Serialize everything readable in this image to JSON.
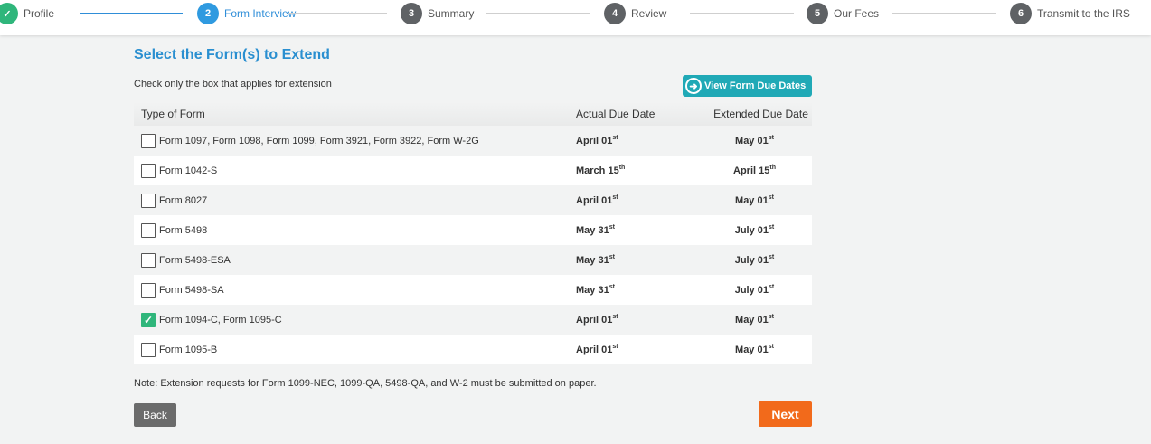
{
  "stepper": {
    "steps": [
      {
        "number": "✓",
        "label": "Profile",
        "state": "done"
      },
      {
        "number": "2",
        "label": "Form Interview",
        "state": "active"
      },
      {
        "number": "3",
        "label": "Summary",
        "state": "pending"
      },
      {
        "number": "4",
        "label": "Review",
        "state": "pending"
      },
      {
        "number": "5",
        "label": "Our Fees",
        "state": "pending"
      },
      {
        "number": "6",
        "label": "Transmit to the IRS",
        "state": "pending"
      }
    ]
  },
  "main": {
    "title": "Select the Form(s) to Extend",
    "instruction": "Check only the box that applies for extension",
    "due_dates_button": "View Form Due Dates",
    "table": {
      "headers": [
        "Type of Form",
        "Actual Due Date",
        "Extended Due Date"
      ],
      "rows": [
        {
          "form": "Form 1097, Form 1098, Form 1099, Form 3921, Form 3922, Form W-2G",
          "actual": "April 01",
          "actual_sup": "st",
          "extended": "May 01",
          "extended_sup": "st",
          "checked": false
        },
        {
          "form": "Form 1042-S",
          "actual": "March 15",
          "actual_sup": "th",
          "extended": "April 15",
          "extended_sup": "th",
          "checked": false
        },
        {
          "form": "Form 8027",
          "actual": "April 01",
          "actual_sup": "st",
          "extended": "May 01",
          "extended_sup": "st",
          "checked": false
        },
        {
          "form": "Form 5498",
          "actual": "May 31",
          "actual_sup": "st",
          "extended": "July 01",
          "extended_sup": "st",
          "checked": false
        },
        {
          "form": "Form 5498-ESA",
          "actual": "May 31",
          "actual_sup": "st",
          "extended": "July 01",
          "extended_sup": "st",
          "checked": false
        },
        {
          "form": "Form 5498-SA",
          "actual": "May 31",
          "actual_sup": "st",
          "extended": "July 01",
          "extended_sup": "st",
          "checked": false
        },
        {
          "form": "Form 1094-C, Form 1095-C",
          "actual": "April 01",
          "actual_sup": "st",
          "extended": "May 01",
          "extended_sup": "st",
          "checked": true
        },
        {
          "form": "Form 1095-B",
          "actual": "April 01",
          "actual_sup": "st",
          "extended": "May 01",
          "extended_sup": "st",
          "checked": false
        }
      ]
    },
    "note": "Note: Extension requests for Form 1099-NEC, 1099-QA, 5498-QA, and W-2 must be submitted on paper.",
    "back_label": "Back",
    "next_label": "Next"
  },
  "colors": {
    "accent": "#2a8fd0",
    "done": "#2fb67b",
    "teal_button": "#20a9b6",
    "next_button": "#f26a1b",
    "back_button": "#6b6b6b"
  }
}
